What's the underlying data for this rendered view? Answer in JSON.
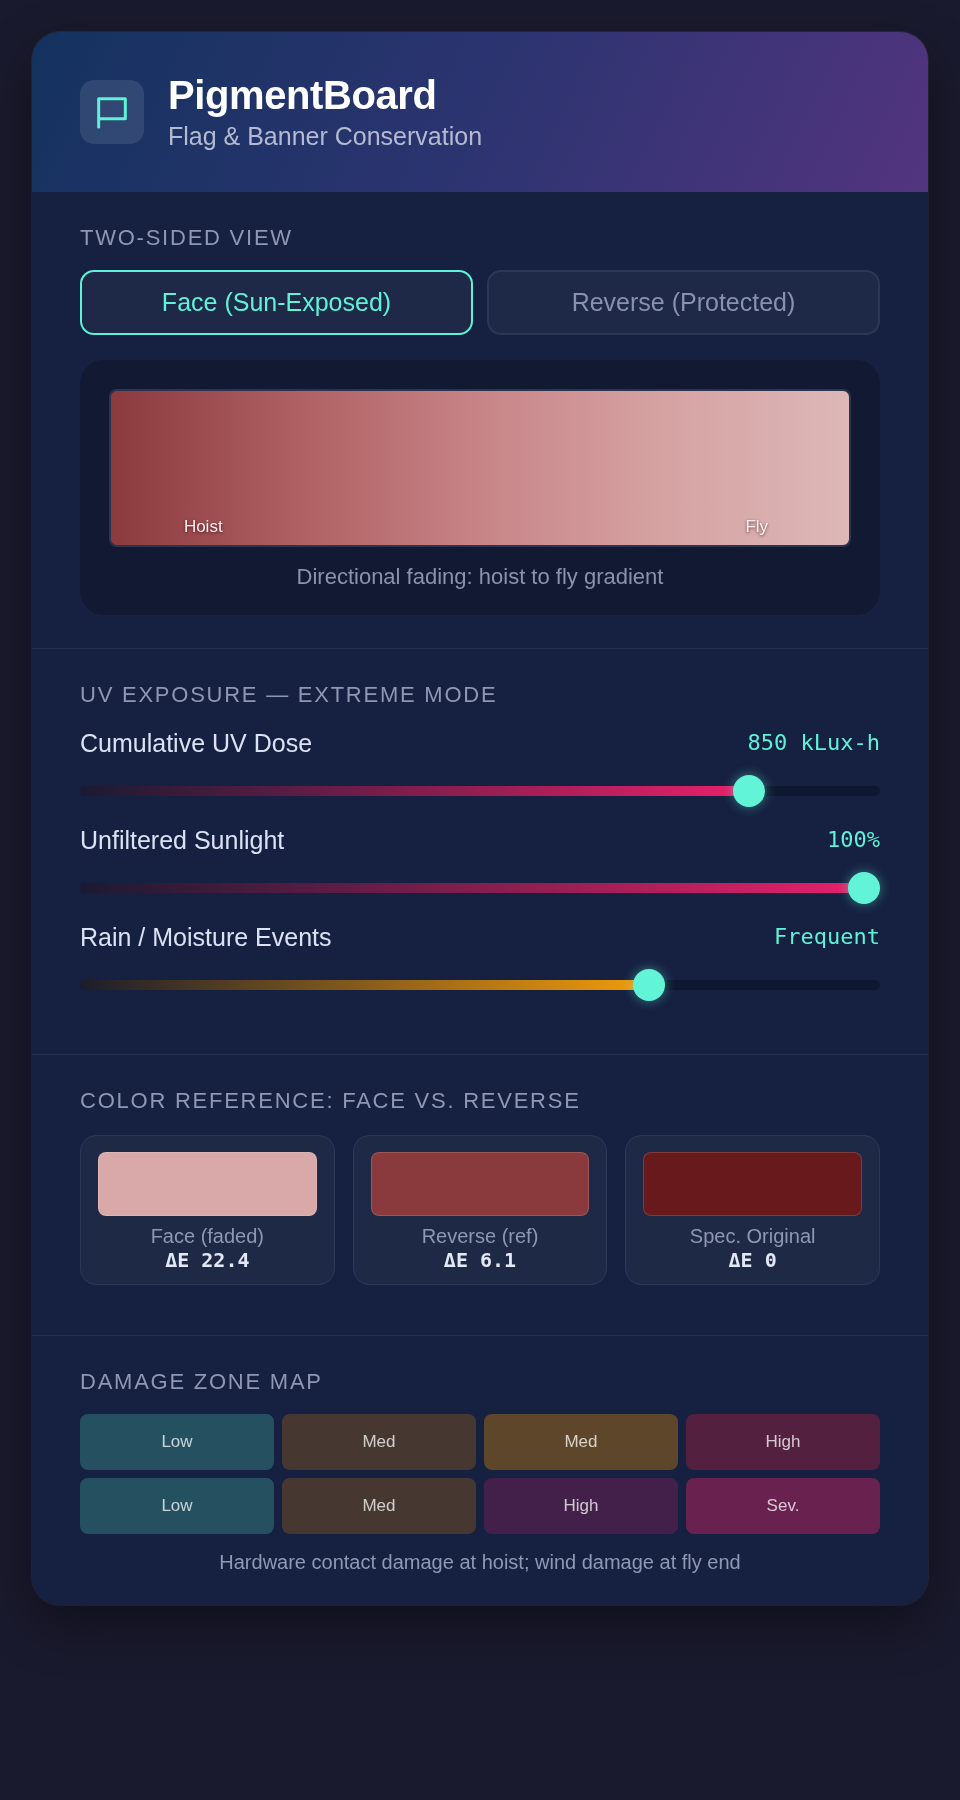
{
  "header": {
    "title": "PigmentBoard",
    "subtitle": "Flag & Banner Conservation"
  },
  "two_sided_view": {
    "heading": "TWO-SIDED VIEW",
    "tabs": [
      {
        "label": "Face (Sun-Exposed)",
        "selected": true
      },
      {
        "label": "Reverse (Protected)",
        "selected": false
      }
    ],
    "gradient": {
      "end_labels": [
        "Hoist",
        "Fly"
      ],
      "caption": "Directional fading: hoist to fly gradient"
    }
  },
  "uv_exposure": {
    "heading": "UV EXPOSURE — EXTREME MODE",
    "sliders": [
      {
        "label": "Cumulative UV Dose",
        "reading": "850 kLux-h",
        "level": 0.85,
        "kind": "uv"
      },
      {
        "label": "Unfiltered Sunlight",
        "reading": "100%",
        "level": 1,
        "kind": "uv"
      },
      {
        "label": "Rain / Moisture Events",
        "reading": "Frequent",
        "level": 0.72,
        "kind": "moisture"
      }
    ]
  },
  "color_reference": {
    "heading": "COLOR REFERENCE: FACE VS. REVERSE",
    "swatches": [
      {
        "label": "Face (faded)",
        "delta": "ΔE 22.4",
        "color": "#d8a9a8"
      },
      {
        "label": "Reverse (ref)",
        "delta": "ΔE 6.1",
        "color": "#8a393c"
      },
      {
        "label": "Spec. Original",
        "delta": "ΔE 0",
        "color": "#68191c"
      }
    ]
  },
  "damage_zone_map": {
    "heading": "DAMAGE ZONE MAP",
    "rows": [
      {
        "cells": [
          {
            "label": "Low",
            "color": "#25505f"
          },
          {
            "label": "Med",
            "color": "#463830"
          },
          {
            "label": "Med",
            "color": "#5d4629"
          },
          {
            "label": "High",
            "color": "#53203f"
          }
        ]
      },
      {
        "cells": [
          {
            "label": "Low",
            "color": "#25505f"
          },
          {
            "label": "Med",
            "color": "#463830"
          },
          {
            "label": "High",
            "color": "#42204a"
          },
          {
            "label": "Sev.",
            "color": "#69214f"
          }
        ]
      }
    ],
    "caption": "Hardware contact damage at hoist; wind damage at fly end"
  }
}
